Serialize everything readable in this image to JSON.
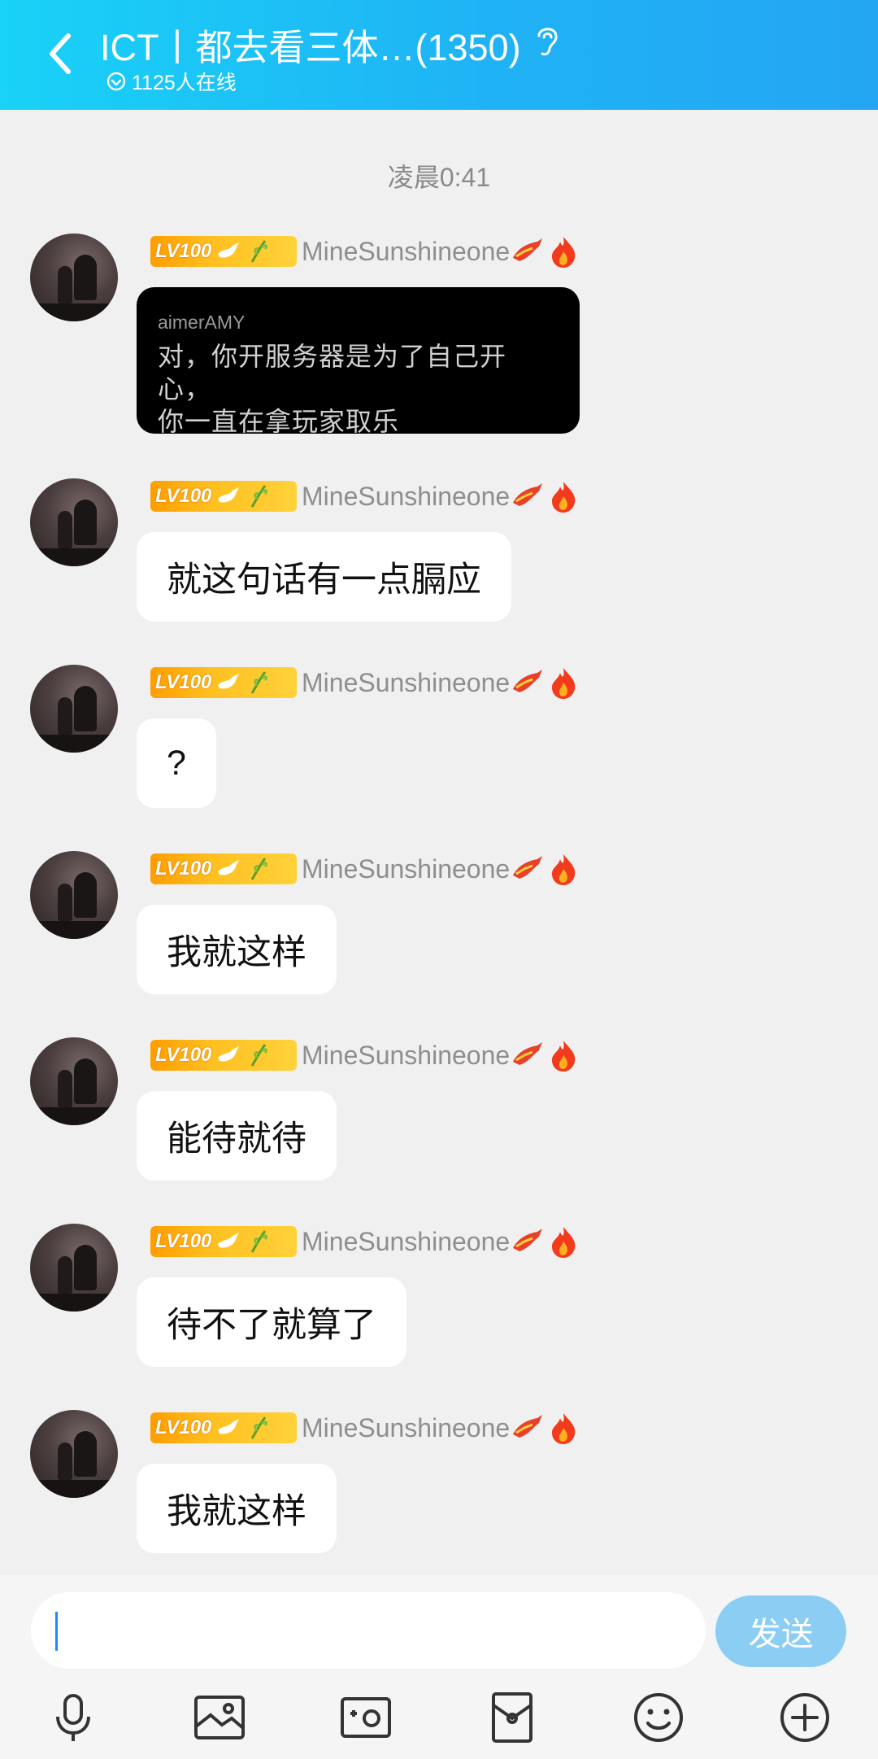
{
  "header": {
    "title": "ICT丨都去看三体…(1350)",
    "online": "1125人在线"
  },
  "timestamp": "凌晨0:41",
  "sender": {
    "level": "LV100",
    "name": "MineSunshineone"
  },
  "messages": [
    {
      "type": "quote",
      "quote_user": "aimerAMY",
      "text_line1": "对，你开服务器是为了自己开心，",
      "text_line2": "你一直在拿玩家取乐"
    },
    {
      "type": "text",
      "text": "就这句话有一点膈应"
    },
    {
      "type": "text",
      "text": "?"
    },
    {
      "type": "text",
      "text": "我就这样"
    },
    {
      "type": "text",
      "text": "能待就待"
    },
    {
      "type": "text",
      "text": "待不了就算了"
    },
    {
      "type": "text",
      "text": "我就这样"
    }
  ],
  "input": {
    "value": ""
  },
  "send_label": "发送",
  "toolbar": [
    "microphone-icon",
    "image-icon",
    "camera-icon",
    "red-packet-icon",
    "emoji-icon",
    "plus-icon"
  ]
}
